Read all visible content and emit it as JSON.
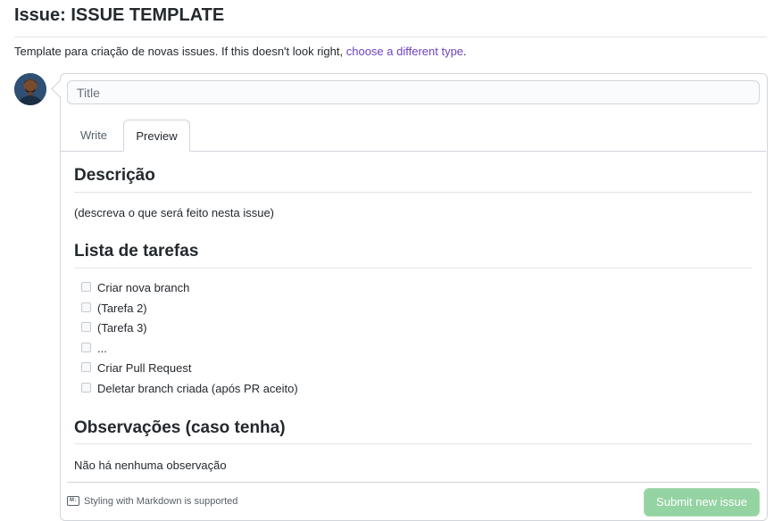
{
  "page": {
    "title": "Issue: ISSUE TEMPLATE",
    "template_note": "Template para criação de novas issues. If this doesn't look right, ",
    "template_link": "choose a different type",
    "template_note_end": "."
  },
  "form": {
    "title_placeholder": "Title",
    "tabs": [
      {
        "label": "Write",
        "active": false
      },
      {
        "label": "Preview",
        "active": true
      }
    ],
    "markdown_note": "Styling with Markdown is supported",
    "submit_label": "Submit new issue"
  },
  "preview": {
    "sections": [
      {
        "heading": "Descrição",
        "text": "(descreva o que será feito nesta issue)"
      },
      {
        "heading": "Lista de tarefas"
      },
      {
        "heading": "Observações (caso tenha)",
        "text": "Não há nenhuma observação"
      }
    ],
    "tasks": [
      "Criar nova branch",
      "(Tarefa 2)",
      "(Tarefa 3)",
      "...",
      "Criar Pull Request",
      "Deletar branch criada (após PR aceito)"
    ]
  },
  "colors": {
    "link": "#6f42c1",
    "submit_bg": "#94d3a2",
    "border": "#d1d5da"
  },
  "icons": [
    "avatar",
    "markdown-icon",
    "checkbox-icon"
  ]
}
